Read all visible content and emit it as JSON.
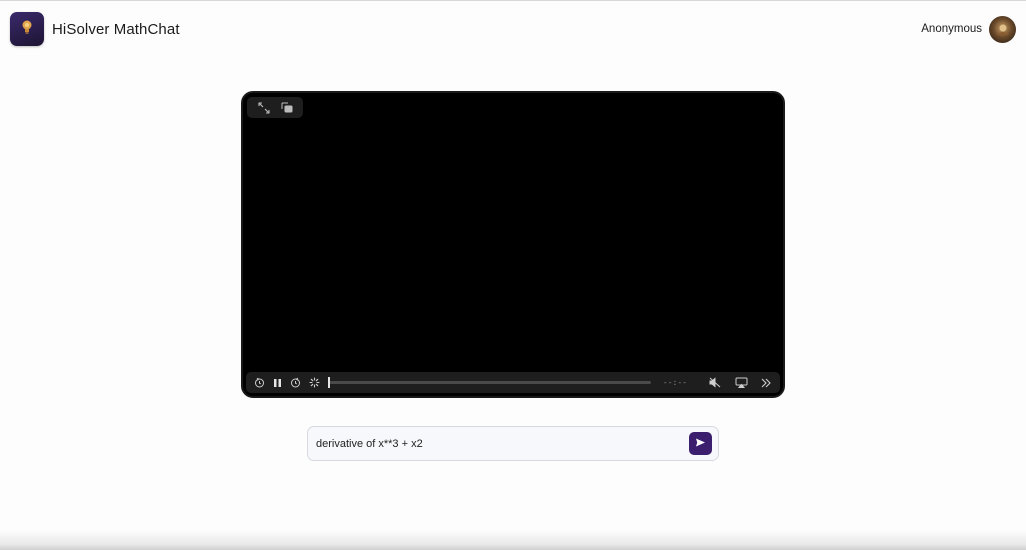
{
  "header": {
    "app_title": "HiSolver MathChat",
    "logo_icon": "lightbulb-icon",
    "user_name": "Anonymous",
    "avatar_icon": "avatar-icon"
  },
  "player": {
    "time_display": "--:--",
    "progress": 0.0,
    "top_icons": [
      "fullscreen-icon",
      "picture-in-picture-icon"
    ],
    "bottom_icons": [
      "rewind-icon",
      "pause-icon",
      "forward-icon",
      "loading-spinner-icon",
      "mute-icon",
      "airplay-icon",
      "more-icon"
    ]
  },
  "chat": {
    "input_value": "derivative of x**3 + x2",
    "send_icon": "send-icon"
  },
  "colors": {
    "accent": "#3b1e6e",
    "player_bg": "#000000",
    "control_bar": "#1e1e1e"
  }
}
